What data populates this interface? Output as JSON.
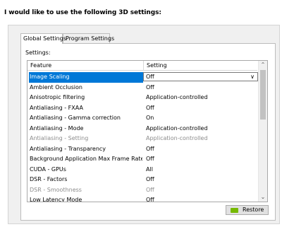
{
  "heading": "I would like to use the following 3D settings:",
  "tabs": [
    {
      "label": "Global Settings",
      "active": true
    },
    {
      "label": "Program Settings",
      "active": false
    }
  ],
  "settings_label": "Settings:",
  "table": {
    "headers": [
      "Feature",
      "Setting"
    ],
    "rows": [
      {
        "feature": "Image Scaling",
        "setting": "Off",
        "selected": true,
        "disabled": false
      },
      {
        "feature": "Ambient Occlusion",
        "setting": "Off",
        "selected": false,
        "disabled": false
      },
      {
        "feature": "Anisotropic filtering",
        "setting": "Application-controlled",
        "selected": false,
        "disabled": false
      },
      {
        "feature": "Antialiasing - FXAA",
        "setting": "Off",
        "selected": false,
        "disabled": false
      },
      {
        "feature": "Antialiasing - Gamma correction",
        "setting": "On",
        "selected": false,
        "disabled": false
      },
      {
        "feature": "Antialiasing - Mode",
        "setting": "Application-controlled",
        "selected": false,
        "disabled": false
      },
      {
        "feature": "Antialiasing - Setting",
        "setting": "Application-controlled",
        "selected": false,
        "disabled": true
      },
      {
        "feature": "Antialiasing - Transparency",
        "setting": "Off",
        "selected": false,
        "disabled": false
      },
      {
        "feature": "Background Application Max Frame Rate",
        "setting": "Off",
        "selected": false,
        "disabled": false
      },
      {
        "feature": "CUDA - GPUs",
        "setting": "All",
        "selected": false,
        "disabled": false
      },
      {
        "feature": "DSR - Factors",
        "setting": "Off",
        "selected": false,
        "disabled": false
      },
      {
        "feature": "DSR - Smoothness",
        "setting": "Off",
        "selected": false,
        "disabled": true
      },
      {
        "feature": "Low Latency Mode",
        "setting": "Off",
        "selected": false,
        "disabled": false
      }
    ]
  },
  "restore_button": "Restore",
  "colors": {
    "accent": "#0078d7",
    "nvidia_green": "#76b900"
  }
}
